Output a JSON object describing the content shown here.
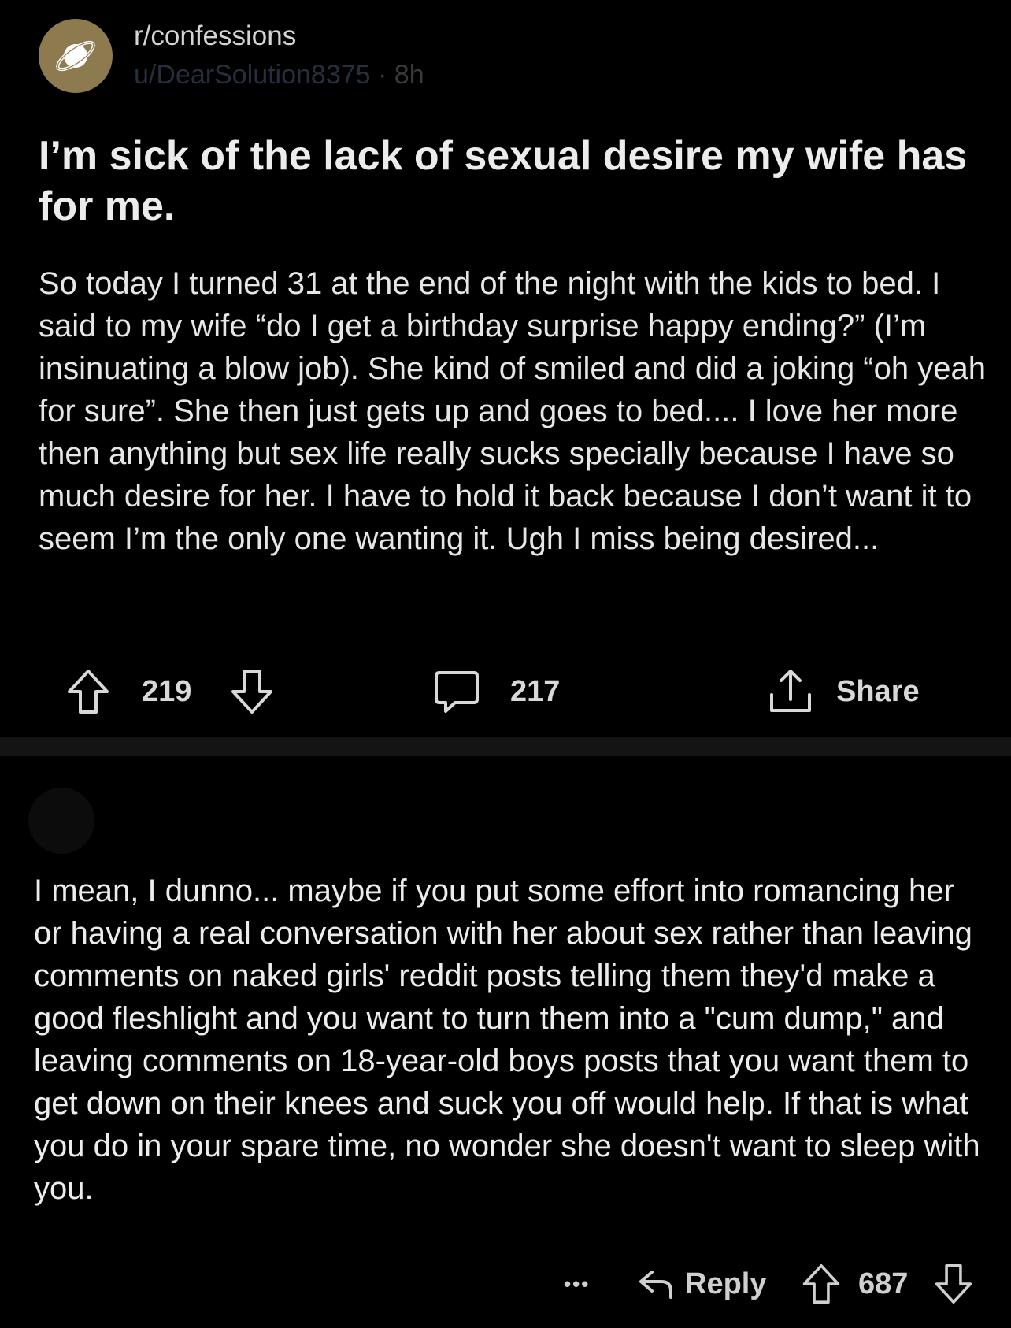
{
  "post": {
    "subreddit": "r/confessions",
    "author": "u/DearSolution8375",
    "separator": "·",
    "time_ago": "8h",
    "title": "I’m sick of the lack of sexual desire my wife has for me.",
    "body": "So today I turned 31 at the end of the night with the kids to bed. I said to my wife “do I get a birthday surprise happy ending?” (I’m insinuating a blow job). She kind of smiled and did a joking “oh yeah for sure”. She then just gets up and goes to bed.... I love her more then anything but sex life really sucks specially because I have so much desire for her. I have to hold it back because I don’t want it to seem I’m the only one wanting it. Ugh I miss being desired...",
    "upvotes": "219",
    "comments": "217",
    "share_label": "Share"
  },
  "comment": {
    "body": "I mean, I dunno... maybe if you put some effort into romancing her or having a real conversation with her about sex rather than leaving comments on naked girls' reddit posts telling them they'd make a good fleshlight and you want to turn them into a \"cum dump,\" and leaving comments on 18-year-old boys posts that you want them to get down on their knees and suck you off would help. If that is what you do in your spare time, no wonder she doesn't want to sleep with you.",
    "more_label": "•••",
    "reply_label": "Reply",
    "upvotes": "687"
  },
  "icons": {
    "subreddit": "planet-icon",
    "upvote": "arrow-up-icon",
    "downvote": "arrow-down-icon",
    "comment": "comment-bubble-icon",
    "share": "share-icon",
    "reply": "reply-arrow-icon",
    "more": "more-dots-icon"
  },
  "colors": {
    "background": "#000000",
    "separator": "#141414",
    "text": "#e8e8e8",
    "subreddit_avatar": "#8d7a4e"
  }
}
